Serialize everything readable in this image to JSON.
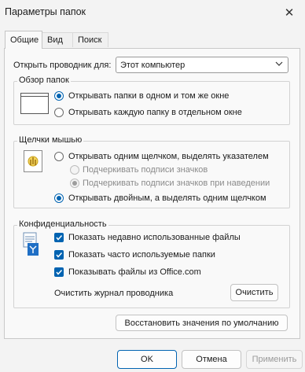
{
  "window": {
    "title": "Параметры папок"
  },
  "tabs": [
    {
      "label": "Общие"
    },
    {
      "label": "Вид"
    },
    {
      "label": "Поиск"
    }
  ],
  "open_explorer": {
    "label": "Открыть проводник для:",
    "value": "Этот компьютер"
  },
  "browse_folders": {
    "legend": "Обзор папок",
    "options": [
      {
        "label": "Открывать папки в одном и том же окне",
        "selected": true
      },
      {
        "label": "Открывать каждую папку в отдельном окне",
        "selected": false
      }
    ]
  },
  "mouse_clicks": {
    "legend": "Щелчки мышью",
    "single_click": {
      "label": "Открывать одним щелчком, выделять указателем",
      "selected": false
    },
    "underline_always": {
      "label": "Подчеркивать подписи значков",
      "selected": false,
      "disabled": true
    },
    "underline_hover": {
      "label": "Подчеркивать подписи значков при наведении",
      "selected": true,
      "disabled": true
    },
    "double_click": {
      "label": "Открывать двойным, а выделять одним щелчком",
      "selected": true
    }
  },
  "privacy": {
    "legend": "Конфиденциальность",
    "items": [
      {
        "label": "Показать недавно использованные файлы",
        "checked": true
      },
      {
        "label": "Показать часто используемые папки",
        "checked": true
      },
      {
        "label": "Показывать файлы из Office.com",
        "checked": true
      }
    ],
    "clear_label": "Очистить журнал проводника",
    "clear_button": "Очистить"
  },
  "restore_defaults": "Восстановить значения по умолчанию",
  "buttons": {
    "ok": "OK",
    "cancel": "Отмена",
    "apply": "Применить"
  },
  "colors": {
    "accent": "#0063b1"
  }
}
